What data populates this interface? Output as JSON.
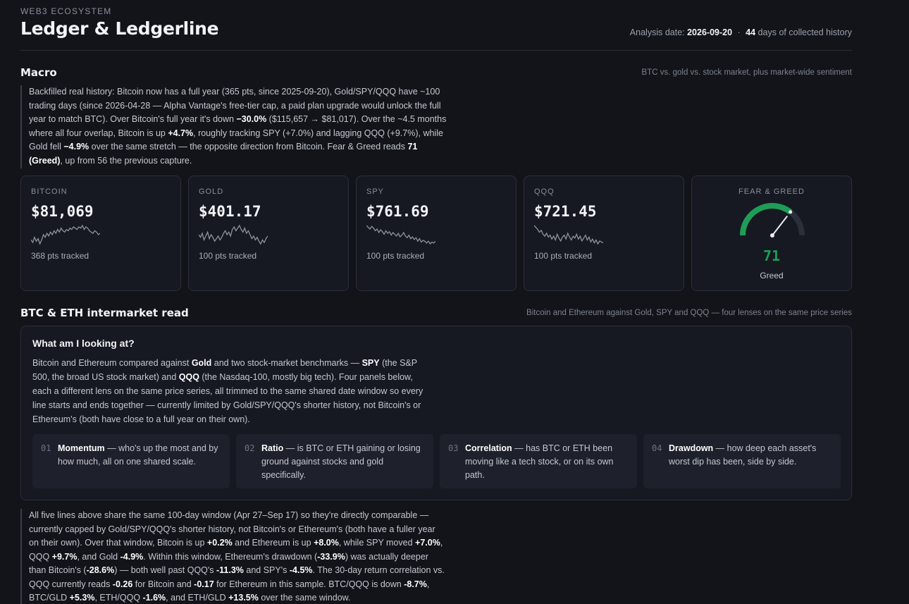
{
  "header": {
    "eyebrow": "WEB3 ECOSYSTEM",
    "title": "Ledger & Ledgerline",
    "analysis_label": "Analysis date:",
    "analysis_date": "2026-09-20",
    "separator": "·",
    "days_count": "44",
    "days_label": "days of collected history"
  },
  "macro": {
    "title": "Macro",
    "subtitle": "BTC vs. gold vs. stock market, plus market-wide sentiment",
    "note_parts": [
      {
        "t": "Backfilled real history: Bitcoin now has a full year (365 pts, since 2025-09-20), Gold/SPY/QQQ have ~100 trading days (since 2026-04-28 — Alpha Vantage's free-tier cap, a paid plan upgrade would unlock the full year to match BTC). Over Bitcoin's full year it's down ",
        "b": false
      },
      {
        "t": "−30.0%",
        "b": true
      },
      {
        "t": " ($115,657 → $81,017). Over the ~4.5 months where all four overlap, Bitcoin is up ",
        "b": false
      },
      {
        "t": "+4.7%",
        "b": true
      },
      {
        "t": ", roughly tracking SPY (+7.0%) and lagging QQQ (+9.7%), while Gold fell ",
        "b": false
      },
      {
        "t": "−4.9%",
        "b": true
      },
      {
        "t": " over the same stretch — the opposite direction from Bitcoin. Fear & Greed reads ",
        "b": false
      },
      {
        "t": "71 (Greed)",
        "b": true
      },
      {
        "t": ", up from 56 the previous capture.",
        "b": false
      }
    ],
    "cards": [
      {
        "label": "BITCOIN",
        "value": "$81,069",
        "pts": "368 pts tracked",
        "spark": [
          20,
          18,
          22,
          19,
          21,
          17,
          20,
          24,
          22,
          25,
          23,
          26,
          24,
          27,
          25,
          28,
          26,
          29,
          27,
          26,
          28,
          27,
          29,
          28,
          30,
          29,
          28,
          30,
          29,
          31,
          28,
          30,
          29,
          27,
          26,
          25,
          27,
          26,
          24,
          25
        ]
      },
      {
        "label": "GOLD",
        "value": "$401.17",
        "pts": "100 pts tracked",
        "spark": [
          22,
          20,
          23,
          18,
          21,
          24,
          19,
          22,
          20,
          17,
          19,
          21,
          18,
          20,
          23,
          25,
          22,
          24,
          21,
          26,
          28,
          25,
          27,
          29,
          26,
          24,
          27,
          23,
          25,
          22,
          19,
          21,
          18,
          20,
          17,
          15,
          18,
          16,
          19,
          21
        ]
      },
      {
        "label": "SPY",
        "value": "$761.69",
        "pts": "100 pts tracked",
        "spark": [
          30,
          28,
          26,
          29,
          27,
          24,
          26,
          22,
          25,
          23,
          20,
          24,
          21,
          23,
          19,
          22,
          20,
          18,
          21,
          17,
          19,
          22,
          18,
          16,
          19,
          15,
          17,
          14,
          16,
          12,
          15,
          11,
          13,
          12,
          10,
          12,
          9,
          11,
          10,
          12
        ]
      },
      {
        "label": "QQQ",
        "value": "$721.45",
        "pts": "100 pts tracked",
        "spark": [
          31,
          29,
          27,
          24,
          26,
          22,
          20,
          23,
          19,
          21,
          17,
          20,
          16,
          22,
          18,
          15,
          19,
          21,
          17,
          23,
          19,
          16,
          20,
          18,
          22,
          17,
          20,
          15,
          18,
          21,
          16,
          19,
          14,
          17,
          13,
          16,
          12,
          15,
          14,
          13
        ]
      }
    ],
    "fear_greed": {
      "label": "FEAR & GREED",
      "value": 71,
      "display": "71",
      "word": "Greed",
      "color": "#1f9d57"
    }
  },
  "intermarket": {
    "title": "BTC & ETH intermarket read",
    "subtitle": "Bitcoin and Ethereum against Gold, SPY and QQQ — four lenses on the same price series",
    "panel_title": "What am I looking at?",
    "panel_parts": [
      {
        "t": "Bitcoin and Ethereum compared against ",
        "b": false
      },
      {
        "t": "Gold",
        "b": true
      },
      {
        "t": " and two stock-market benchmarks — ",
        "b": false
      },
      {
        "t": "SPY",
        "b": true
      },
      {
        "t": " (the S&P 500, the broad US stock market) and ",
        "b": false
      },
      {
        "t": "QQQ",
        "b": true
      },
      {
        "t": " (the Nasdaq-100, mostly big tech). Four panels below, each a different lens on the same price series, all trimmed to the same shared date window so every line starts and ends together — currently limited by Gold/SPY/QQQ's shorter history, not Bitcoin's or Ethereum's (both have close to a full year on their own).",
        "b": false
      }
    ],
    "lenses": [
      {
        "num": "01",
        "name": "Momentum",
        "desc": " — who's up the most and by how much, all on one shared scale."
      },
      {
        "num": "02",
        "name": "Ratio",
        "desc": " — is BTC or ETH gaining or losing ground against stocks and gold specifically."
      },
      {
        "num": "03",
        "name": "Correlation",
        "desc": " — has BTC or ETH been moving like a tech stock, or on its own path."
      },
      {
        "num": "04",
        "name": "Drawdown",
        "desc": " — how deep each asset's worst dip has been, side by side."
      }
    ],
    "note_parts": [
      {
        "t": "All five lines above share the same 100-day window (Apr 27–Sep 17) so they're directly comparable — currently capped by Gold/SPY/QQQ's shorter history, not Bitcoin's or Ethereum's (both have a fuller year on their own). Over that window, Bitcoin is up ",
        "b": false
      },
      {
        "t": "+0.2%",
        "b": true
      },
      {
        "t": " and Ethereum is up ",
        "b": false
      },
      {
        "t": "+8.0%",
        "b": true
      },
      {
        "t": ", while SPY moved ",
        "b": false
      },
      {
        "t": "+7.0%",
        "b": true
      },
      {
        "t": ", QQQ ",
        "b": false
      },
      {
        "t": "+9.7%",
        "b": true
      },
      {
        "t": ", and Gold ",
        "b": false
      },
      {
        "t": "-4.9%",
        "b": true
      },
      {
        "t": ". Within this window, Ethereum's drawdown (",
        "b": false
      },
      {
        "t": "-33.9%",
        "b": true
      },
      {
        "t": ") was actually deeper than Bitcoin's (",
        "b": false
      },
      {
        "t": "-28.6%",
        "b": true
      },
      {
        "t": ") — both well past QQQ's ",
        "b": false
      },
      {
        "t": "-11.3%",
        "b": true
      },
      {
        "t": " and SPY's ",
        "b": false
      },
      {
        "t": "-4.5%",
        "b": true
      },
      {
        "t": ". The 30-day return correlation vs. QQQ currently reads ",
        "b": false
      },
      {
        "t": "-0.26",
        "b": true
      },
      {
        "t": " for Bitcoin and ",
        "b": false
      },
      {
        "t": "-0.17",
        "b": true
      },
      {
        "t": " for Ethereum in this sample. BTC/QQQ is down ",
        "b": false
      },
      {
        "t": "-8.7%",
        "b": true
      },
      {
        "t": ", BTC/GLD ",
        "b": false
      },
      {
        "t": "+5.3%",
        "b": true
      },
      {
        "t": ", ETH/QQQ ",
        "b": false
      },
      {
        "t": "-1.6%",
        "b": true
      },
      {
        "t": ", and ETH/GLD ",
        "b": false
      },
      {
        "t": "+13.5%",
        "b": true
      },
      {
        "t": " over the same window.",
        "b": false
      }
    ]
  },
  "colors": {
    "spark": "#8d929c",
    "gauge_track": "#2b2f39",
    "gauge_fill": "#1f9d57"
  }
}
